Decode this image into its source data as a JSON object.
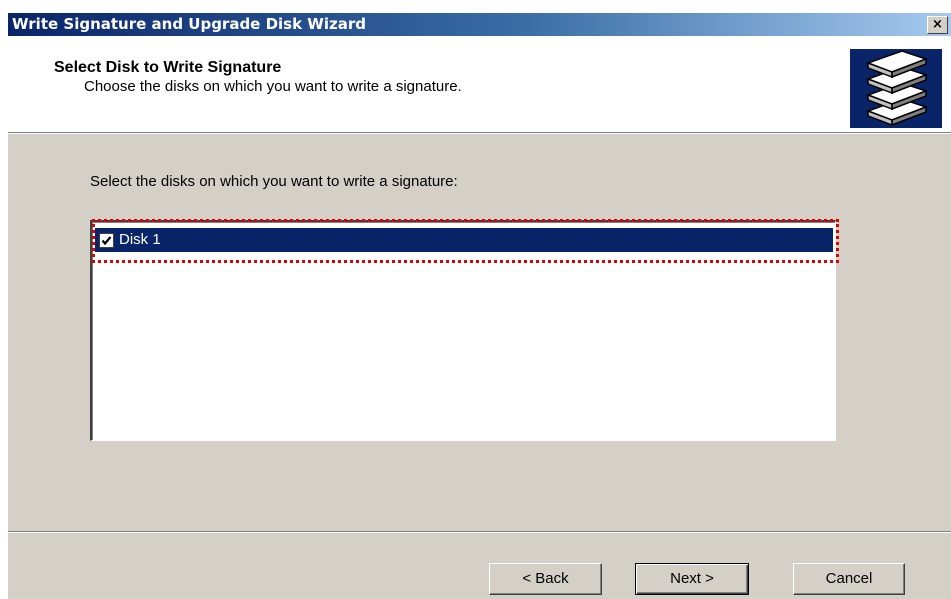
{
  "window": {
    "title": "Write Signature and Upgrade Disk Wizard",
    "close_label": "×"
  },
  "header": {
    "title": "Select Disk to Write Signature",
    "subtitle": "Choose the disks on which you want to write a signature.",
    "icon": "disk-stack-icon"
  },
  "body": {
    "prompt": "Select the disks on which you want to write a signature:",
    "disks": [
      {
        "label": "Disk 1",
        "checked": true,
        "selected": true
      }
    ]
  },
  "buttons": {
    "back": "< Back",
    "next": "Next >",
    "cancel": "Cancel"
  },
  "colors": {
    "title_bar_start": "#0a246a",
    "title_bar_end": "#a6caf0",
    "selection": "#0a246a",
    "focus_outline": "#e00000",
    "dialog_face": "#d4d0c8"
  }
}
